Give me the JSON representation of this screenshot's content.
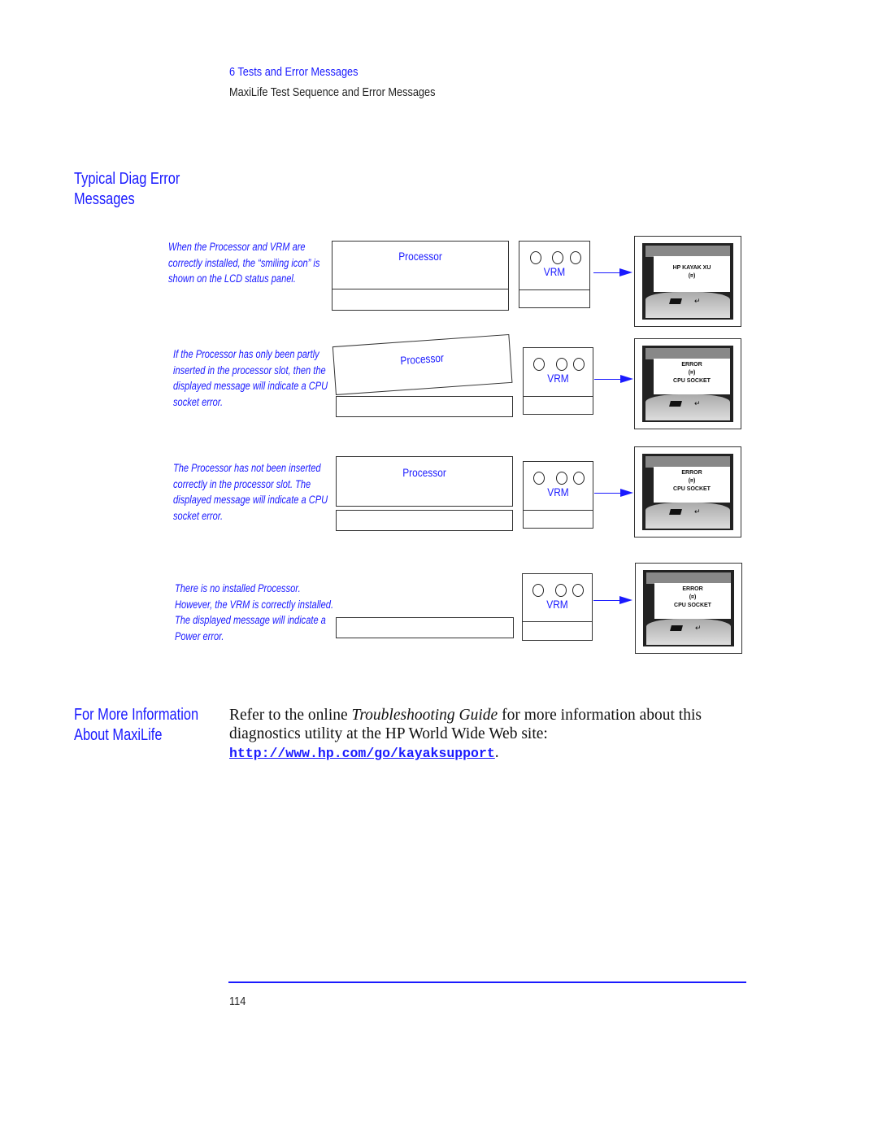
{
  "header": {
    "chapter": "6   Tests and Error Messages",
    "subtitle": "MaxiLife Test Sequence and Error Messages"
  },
  "section1": {
    "title_line1": "Typical Diag Error",
    "title_line2": "Messages"
  },
  "rows": [
    {
      "caption": "When the Processor and VRM are correctly installed, the “smiling icon” is shown on the LCD status panel.",
      "processor": "Processor",
      "vrm": "VRM",
      "lcd_line1": "HP KAYAK XU",
      "lcd_line2": "(¤)",
      "lcd_line3": ""
    },
    {
      "caption": "If the Processor has only been partly inserted in the processor slot, then the displayed message will indicate a CPU socket error.",
      "processor": "Processor",
      "vrm": "VRM",
      "lcd_line1": "ERROR",
      "lcd_line2": "(¤)",
      "lcd_line3": "CPU SOCKET"
    },
    {
      "caption": "The Processor has not been inserted correctly in the processor slot. The displayed message will indicate a CPU socket error.",
      "processor": "Processor",
      "vrm": "VRM",
      "lcd_line1": "ERROR",
      "lcd_line2": "(¤)",
      "lcd_line3": "CPU SOCKET"
    },
    {
      "caption": "There is no installed Processor. However, the VRM is correctly installed. The displayed message will indicate a Power error.",
      "vrm": "VRM",
      "lcd_line1": "ERROR",
      "lcd_line2": "(¤)",
      "lcd_line3": "CPU SOCKET"
    }
  ],
  "section2": {
    "title_line1": "For More Information",
    "title_line2": "About MaxiLife",
    "text_before": "Refer to the online ",
    "italic": "Troubleshooting Guide",
    "text_after": " for more information about this diagnostics utility at the HP World Wide Web site:",
    "link": "http://www.hp.com/go/kayaksupport",
    "link_suffix": "."
  },
  "footer": {
    "page_number": "114",
    "rule_color": "#1a1aff"
  }
}
